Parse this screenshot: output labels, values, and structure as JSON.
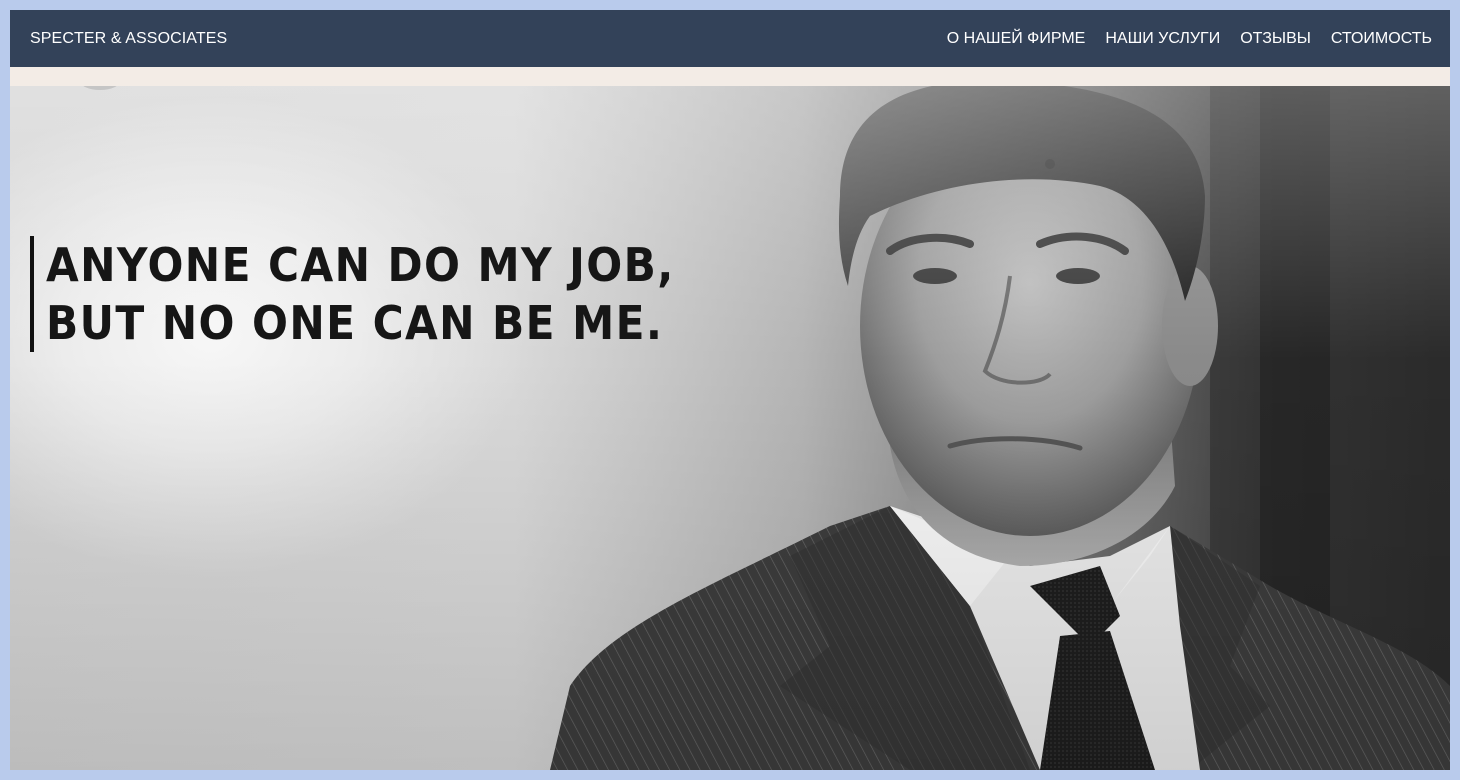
{
  "navbar": {
    "brand": "SPECTER & ASSOCIATES",
    "links": [
      {
        "label": "О НАШЕЙ ФИРМЕ"
      },
      {
        "label": "НАШИ УСЛУГИ"
      },
      {
        "label": "ОТЗЫВЫ"
      },
      {
        "label": "СТОИМОСТЬ"
      }
    ],
    "background": "#334259",
    "text_color": "#ffffff"
  },
  "hero": {
    "quote_lines": [
      "ANYONE CAN DO MY JOB,",
      "BUT NO ONE CAN BE ME."
    ],
    "image_subject": "black-and-white-portrait-man-in-pinstripe-suit"
  },
  "colors": {
    "page_border": "#b9cbec",
    "strip": "#f3ece6"
  }
}
